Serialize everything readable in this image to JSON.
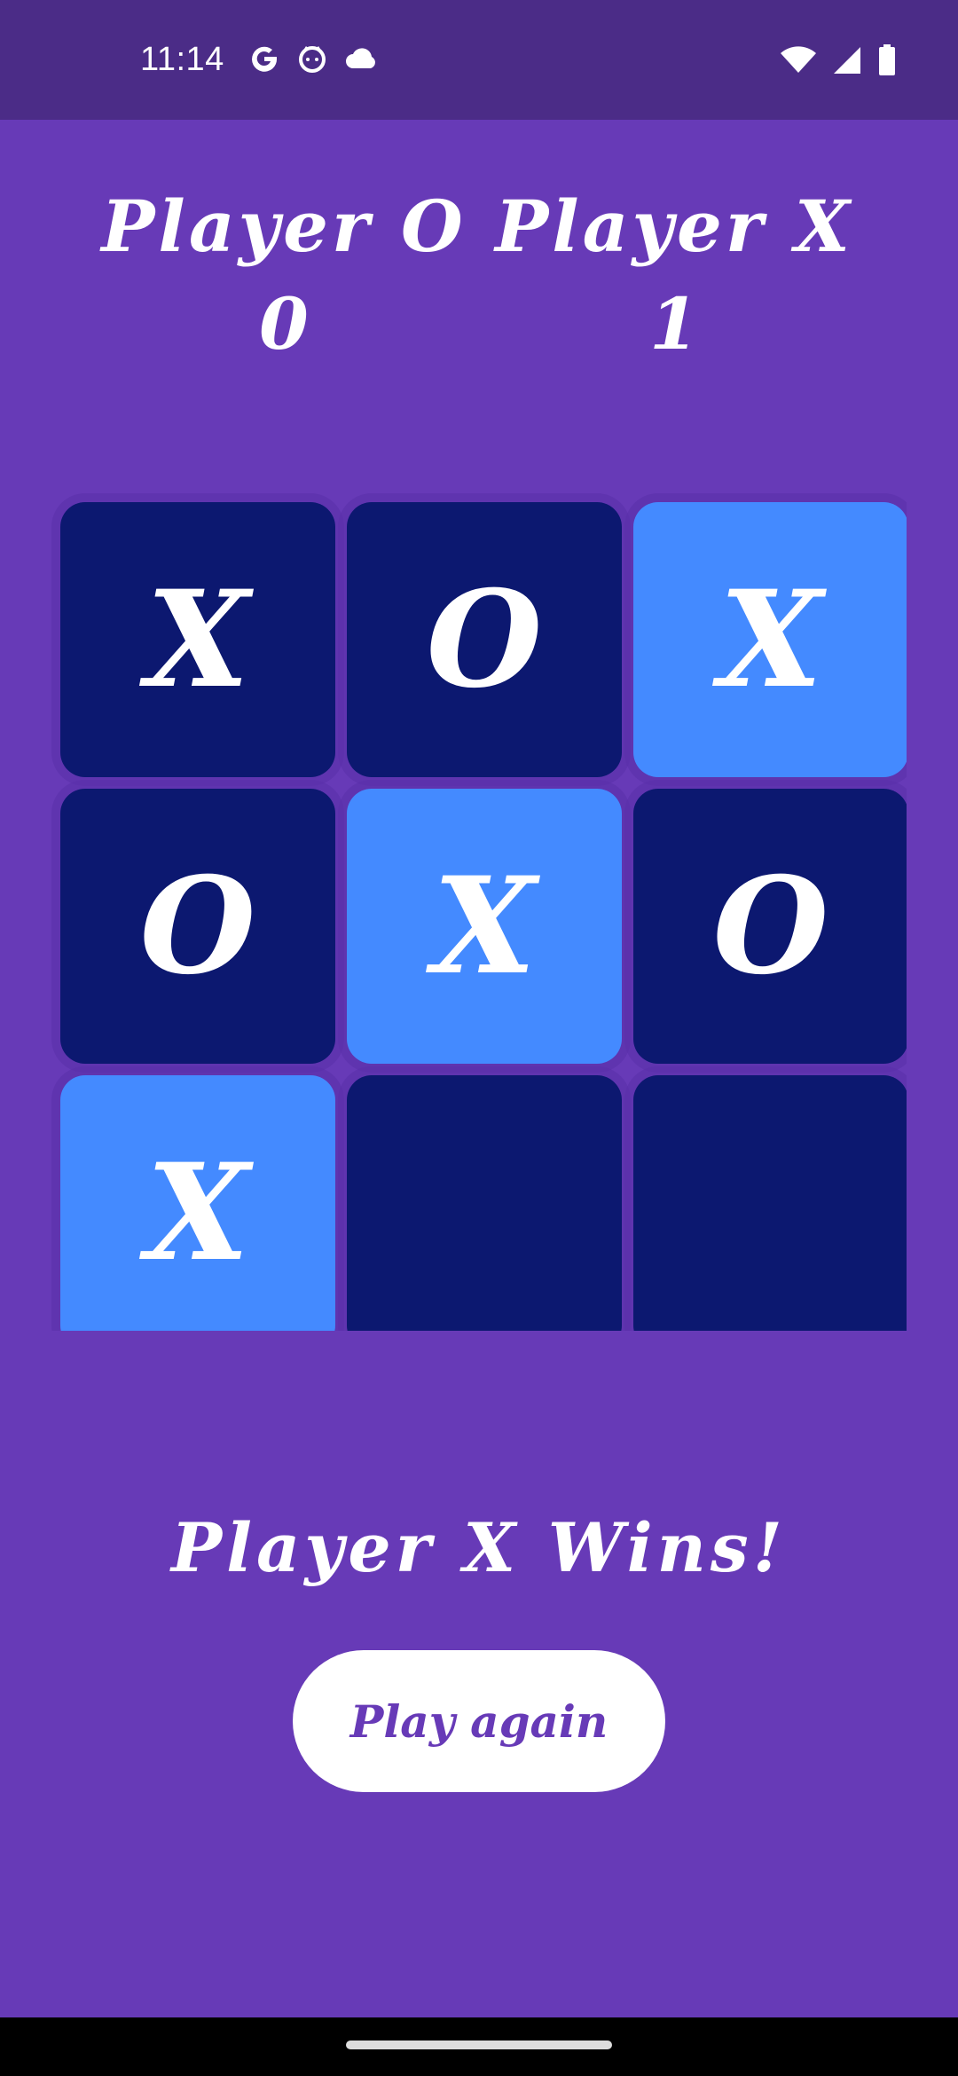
{
  "status_bar": {
    "time": "11:14",
    "left_icons": [
      "google-icon",
      "cat-face-icon",
      "cloud-icon"
    ],
    "right_icons": [
      "wifi-icon",
      "signal-icon",
      "battery-icon"
    ]
  },
  "scores": {
    "player_o": {
      "label": "Player O",
      "score": "0"
    },
    "player_x": {
      "label": "Player X",
      "score": "1"
    }
  },
  "board": {
    "cells": [
      {
        "mark": "X",
        "highlight": false
      },
      {
        "mark": "O",
        "highlight": false
      },
      {
        "mark": "X",
        "highlight": true
      },
      {
        "mark": "O",
        "highlight": false
      },
      {
        "mark": "X",
        "highlight": true
      },
      {
        "mark": "O",
        "highlight": false
      },
      {
        "mark": "X",
        "highlight": true
      },
      {
        "mark": "",
        "highlight": false
      },
      {
        "mark": "",
        "highlight": false
      }
    ]
  },
  "result_text": "Player X Wins!",
  "play_again_label": "Play again",
  "colors": {
    "background": "#673AB7",
    "status_bar": "#4B2C87",
    "cell_default": "#0C1870",
    "cell_winning": "#448AFF",
    "text": "#FFFFFF"
  }
}
